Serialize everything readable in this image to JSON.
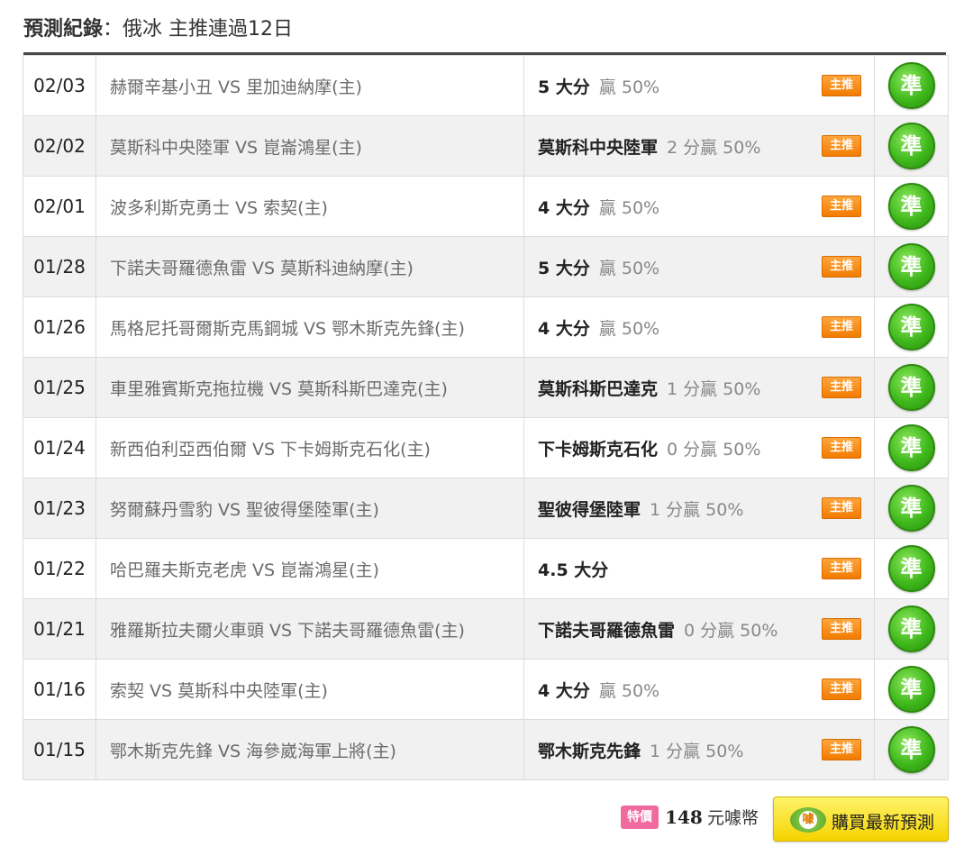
{
  "header": {
    "label": "預測紀錄",
    "separator": "：",
    "subtitle": "俄冰 主推連過12日"
  },
  "rows": [
    {
      "date": "02/03",
      "match": "赫爾辛基小丑 VS 里加迪納摩(主)",
      "pick": "5 大分",
      "result": "贏 50%",
      "tag": "主推",
      "status": "準"
    },
    {
      "date": "02/02",
      "match": "莫斯科中央陸軍 VS 崑崙鴻星(主)",
      "pick": "莫斯科中央陸軍",
      "result": "2 分贏 50%",
      "tag": "主推",
      "status": "準"
    },
    {
      "date": "02/01",
      "match": "波多利斯克勇士 VS 索契(主)",
      "pick": "4 大分",
      "result": "贏 50%",
      "tag": "主推",
      "status": "準"
    },
    {
      "date": "01/28",
      "match": "下諾夫哥羅德魚雷 VS 莫斯科迪納摩(主)",
      "pick": "5 大分",
      "result": "贏 50%",
      "tag": "主推",
      "status": "準"
    },
    {
      "date": "01/26",
      "match": "馬格尼托哥爾斯克馬鋼城 VS 鄂木斯克先鋒(主)",
      "pick": "4 大分",
      "result": "贏 50%",
      "tag": "主推",
      "status": "準"
    },
    {
      "date": "01/25",
      "match": "車里雅賓斯克拖拉機 VS 莫斯科斯巴達克(主)",
      "pick": "莫斯科斯巴達克",
      "result": "1 分贏 50%",
      "tag": "主推",
      "status": "準"
    },
    {
      "date": "01/24",
      "match": "新西伯利亞西伯爾 VS 下卡姆斯克石化(主)",
      "pick": "下卡姆斯克石化",
      "result": "0 分贏 50%",
      "tag": "主推",
      "status": "準"
    },
    {
      "date": "01/23",
      "match": "努爾蘇丹雪豹 VS 聖彼得堡陸軍(主)",
      "pick": "聖彼得堡陸軍",
      "result": "1 分贏 50%",
      "tag": "主推",
      "status": "準"
    },
    {
      "date": "01/22",
      "match": "哈巴羅夫斯克老虎 VS 崑崙鴻星(主)",
      "pick": "4.5 大分",
      "result": "",
      "tag": "主推",
      "status": "準"
    },
    {
      "date": "01/21",
      "match": "雅羅斯拉夫爾火車頭 VS 下諾夫哥羅德魚雷(主)",
      "pick": "下諾夫哥羅德魚雷",
      "result": "0 分贏 50%",
      "tag": "主推",
      "status": "準"
    },
    {
      "date": "01/16",
      "match": "索契 VS 莫斯科中央陸軍(主)",
      "pick": "4 大分",
      "result": "贏 50%",
      "tag": "主推",
      "status": "準"
    },
    {
      "date": "01/15",
      "match": "鄂木斯克先鋒 VS 海參崴海軍上將(主)",
      "pick": "鄂木斯克先鋒",
      "result": "1 分贏 50%",
      "tag": "主推",
      "status": "準"
    }
  ],
  "footer": {
    "badge": "特價",
    "price": "148",
    "unit": "元噱幣",
    "buy_icon_text": "噱",
    "buy_label": "購買最新預測"
  },
  "colors": {
    "tag": "#f27b00",
    "status": "#3fb81c",
    "badge": "#f06aa0",
    "buy_button": "#f5d300"
  }
}
